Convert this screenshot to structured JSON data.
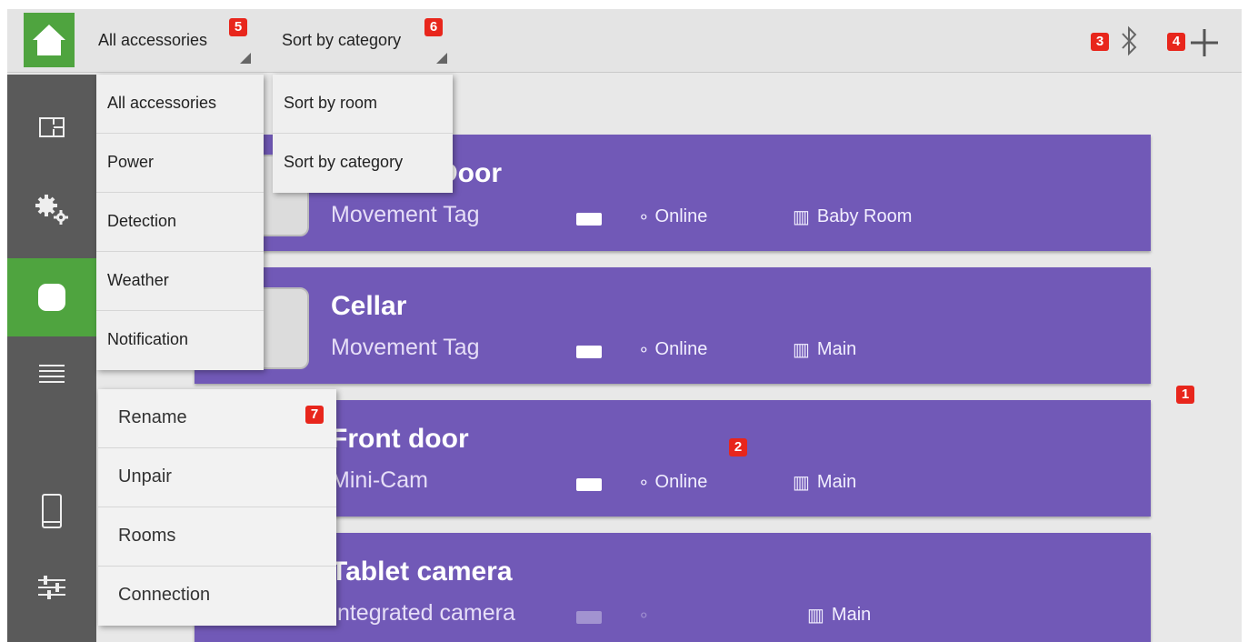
{
  "header": {
    "filter_label": "All accessories",
    "sort_label": "Sort by category",
    "bluetooth_icon": "bluetooth-icon",
    "add_icon": "plus-icon"
  },
  "filter_menu": [
    "All accessories",
    "Power",
    "Detection",
    "Weather",
    "Notification"
  ],
  "sort_menu": [
    "Sort by room",
    "Sort by category"
  ],
  "context_menu": [
    "Rename",
    "Unpair",
    "Rooms",
    "Connection"
  ],
  "sidebar": [
    "floorplan-icon",
    "gears-icon",
    "accessory-icon",
    "list-icon",
    "phone-icon",
    "sliders-icon"
  ],
  "accessories": [
    {
      "name": "Door",
      "type": "Movement Tag",
      "status": "Online",
      "room": "Baby Room"
    },
    {
      "name": "Cellar",
      "type": "Movement Tag",
      "status": "Online",
      "room": "Main"
    },
    {
      "name": "Front door",
      "type": "Mini-Cam",
      "status": "Online",
      "room": "Main"
    },
    {
      "name": "Tablet camera",
      "type": "Integrated camera",
      "status": "",
      "room": "Main"
    }
  ],
  "annotations": [
    "1",
    "2",
    "3",
    "4",
    "5",
    "6",
    "7"
  ],
  "colors": {
    "accent_green": "#4fa43f",
    "card_purple": "#7159b7",
    "sidebar": "#5a5a5a",
    "badge_red": "#e8261c"
  }
}
